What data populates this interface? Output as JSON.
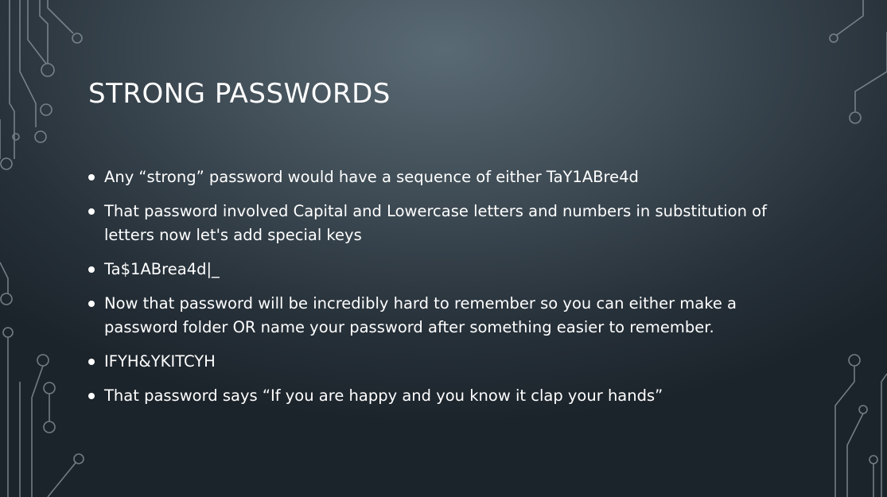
{
  "slide": {
    "title": "STRONG PASSWORDS",
    "bullets": [
      "Any “strong” password would have a sequence of either TaY1ABre4d",
      "That password involved Capital and Lowercase letters and numbers in substitution of letters now let's add special keys",
      "Ta$1ABrea4d|_",
      "Now that password will be incredibly hard to remember so you can either make a password folder OR name your password after something easier to remember.",
      "IFYH&YKITCYH",
      "That password says “If you are happy and you know it clap your hands”"
    ]
  },
  "colors": {
    "background": "#3f4c55",
    "text": "#ffffff",
    "circuit_lines": "#8e9aa2"
  },
  "icons": [
    "circuit-decoration-left",
    "circuit-decoration-right"
  ]
}
